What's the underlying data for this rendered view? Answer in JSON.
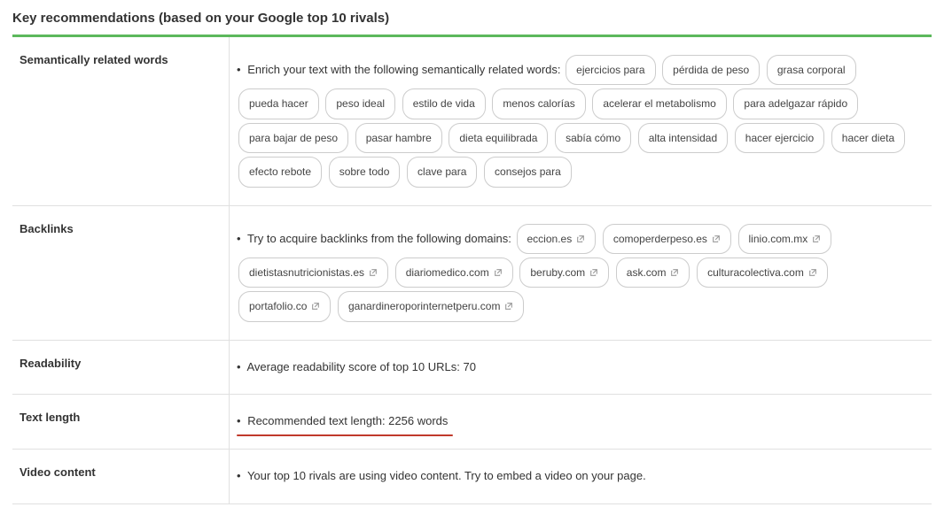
{
  "header": "Key recommendations (based on your Google top 10 rivals)",
  "rows": {
    "semantic": {
      "label": "Semantically related   words",
      "lead": "Enrich your text with the following semantically related words:",
      "pills": [
        "ejercicios para",
        "pérdida de peso",
        "grasa corporal",
        "pueda hacer",
        "peso ideal",
        "estilo de vida",
        "menos calorías",
        "acelerar el metabolismo",
        "para adelgazar rápido",
        "para bajar de peso",
        "pasar hambre",
        "dieta equilibrada",
        "sabía cómo",
        "alta intensidad",
        "hacer ejercicio",
        "hacer dieta",
        "efecto rebote",
        "sobre todo",
        "clave para",
        "consejos para"
      ]
    },
    "backlinks": {
      "label": "Backlinks",
      "lead": "Try to acquire backlinks from the following domains:",
      "pills": [
        "eccion.es",
        "comoperderpeso.es",
        "linio.com.mx",
        "dietistasnutricionistas.es",
        "diariomedico.com",
        "beruby.com",
        "ask.com",
        "culturacolectiva.com",
        "portafolio.co",
        "ganardineroporinternetperu.com"
      ]
    },
    "readability": {
      "label": "Readability",
      "text": "Average readability score of top 10 URLs:  70"
    },
    "textlength": {
      "label": "Text length",
      "text": "Recommended text length:  2256 words"
    },
    "video": {
      "label": "Video content",
      "text": "Your top 10 rivals are using video content. Try to embed a video on your page."
    }
  }
}
